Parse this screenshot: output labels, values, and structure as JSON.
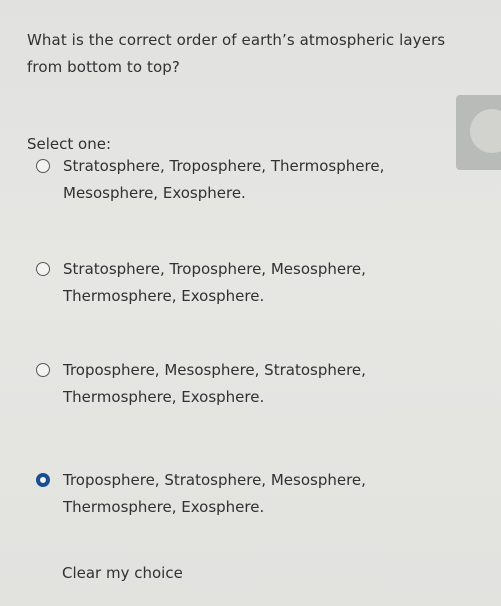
{
  "question": {
    "text": "What is the correct order of earth’s atmospheric layers from bottom to top?"
  },
  "prompt": {
    "select_one": "Select one:"
  },
  "options": [
    {
      "label": "Stratosphere, Troposphere, Thermosphere, Mesosphere, Exosphere.",
      "selected": false
    },
    {
      "label": "Stratosphere, Troposphere, Mesosphere, Thermosphere, Exosphere.",
      "selected": false
    },
    {
      "label": "Troposphere, Mesosphere, Stratosphere, Thermosphere, Exosphere.",
      "selected": false
    },
    {
      "label": "Troposphere, Stratosphere, Mesosphere, Thermosphere, Exosphere.",
      "selected": true
    }
  ],
  "actions": {
    "clear_choice": "Clear my choice"
  },
  "colors": {
    "selected_radio": "#1a4f8f",
    "background": "#e3e4e1",
    "text": "#2f3133"
  }
}
